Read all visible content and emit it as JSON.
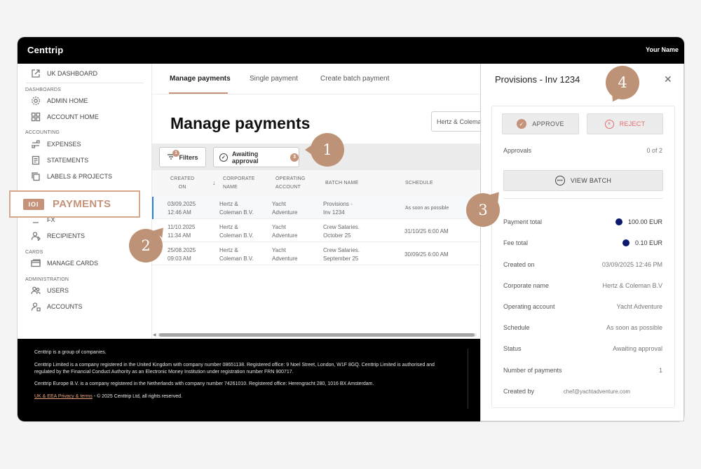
{
  "app": {
    "brand": "Centtrip",
    "user": "Your Name"
  },
  "sidebar": {
    "top_item": {
      "label": "UK DASHBOARD",
      "icon": "external-link-icon"
    },
    "sections": [
      {
        "title": "DASHBOARDS",
        "items": [
          {
            "label": "ADMIN HOME",
            "icon": "gear-icon"
          },
          {
            "label": "ACCOUNT HOME",
            "icon": "grid-icon"
          }
        ]
      },
      {
        "title": "ACCOUNTING",
        "items": [
          {
            "label": "EXPENSES",
            "icon": "receipt-swap-icon"
          },
          {
            "label": "STATEMENTS",
            "icon": "document-icon"
          },
          {
            "label": "LABELS & PROJECTS",
            "icon": "copy-icon"
          }
        ]
      },
      {
        "title": "",
        "items": [
          {
            "label": "PAYMENTS",
            "icon": "payments-icon"
          },
          {
            "label": "FX",
            "icon": "exchange-icon"
          },
          {
            "label": "RECIPIENTS",
            "icon": "recipients-icon"
          }
        ]
      },
      {
        "title": "CARDS",
        "items": [
          {
            "label": "MANAGE CARDS",
            "icon": "card-icon"
          }
        ]
      },
      {
        "title": "ADMINISTRATION",
        "items": [
          {
            "label": "USERS",
            "icon": "users-icon"
          },
          {
            "label": "ACCOUNTS",
            "icon": "accounts-icon"
          }
        ]
      }
    ],
    "highlight": {
      "icon_text": "IOI",
      "label": "PAYMENTS"
    }
  },
  "main": {
    "tabs": [
      {
        "label": "Manage payments",
        "active": true
      },
      {
        "label": "Single payment",
        "active": false
      },
      {
        "label": "Create batch payment",
        "active": false
      }
    ],
    "page_title": "Manage payments",
    "corporate_select": "Hertz & Coleman B.V",
    "filters": {
      "label": "Filters",
      "count": "1"
    },
    "awaiting": {
      "label": "Awaiting approval",
      "count": "3"
    },
    "table": {
      "headers": {
        "created_on_1": "CREATED",
        "created_on_2": "ON",
        "corporate_1": "CORPORATE",
        "corporate_2": "NAME",
        "account_1": "OPERATING",
        "account_2": "ACCOUNT",
        "batch": "BATCH NAME",
        "schedule": "SCHEDULE"
      },
      "rows": [
        {
          "date": "03/09.2025",
          "time": "12:46 AM",
          "corp1": "Hertz &",
          "corp2": "Coleman B.V.",
          "acc1": "Yacht",
          "acc2": "Adventure",
          "batch1": "Provisions -",
          "batch2": "Inv 1234",
          "schedule": "As soon as possible"
        },
        {
          "date": "11/10.2025",
          "time": "11:34 AM",
          "corp1": "Hertz &",
          "corp2": "Coleman B.V.",
          "acc1": "Yacht",
          "acc2": "Adventure",
          "batch1": "Crew Salaries.",
          "batch2": "October 25",
          "schedule": "31/10/25 6:00 AM"
        },
        {
          "date": "25/08.2025",
          "time": "09:03 AM",
          "corp1": "Hertz &",
          "corp2": "Coleman B.V.",
          "acc1": "Yacht",
          "acc2": "Adventure",
          "batch1": "Crew Salaries.",
          "batch2": "September 25",
          "schedule": "30/09/25 6:00 AM"
        }
      ]
    }
  },
  "footer": {
    "line1": "Centtrip is a group of companies.",
    "line2": "Centtrip Limited is a company registered in the United Kingdom with company number 08651138. Registered office: 9 Noel Street, London, W1F 8GQ. Centtrip Limited is authorised and regulated by the Financial Conduct Authority as an Electronic Money Institution under registration number FRN 900717.",
    "line3": "Centtrip Europe B.V. is a company registered in the Netherlands with company number 74261010. Registered office: Herengracht 280, 1016 BX Amsterdam.",
    "link": "UK & EEA Privacy & terms",
    "copyright": " - © 2025 Centtrip Ltd, all rights reserved."
  },
  "panel": {
    "title": "Provisions - Inv 1234",
    "approve": "APPROVE",
    "reject": "REJECT",
    "approvals_label": "Approvals",
    "approvals_value": "0 of 2",
    "view_batch": "VIEW BATCH",
    "details": [
      {
        "label": "Payment total",
        "value": "100.00 EUR",
        "dot": true
      },
      {
        "label": "Fee total",
        "value": "0.10 EUR",
        "dot": true
      },
      {
        "label": "Created on",
        "value": "03/09/2025 12:46 PM"
      },
      {
        "label": "Corporate name",
        "value": "Hertz & Coleman B.V"
      },
      {
        "label": "Operating account",
        "value": "Yacht Adventure"
      },
      {
        "label": "Schedule",
        "value": "As soon as possible"
      },
      {
        "label": "Status",
        "value": "Awaiting approval"
      },
      {
        "label": "Number of payments",
        "value": "1"
      },
      {
        "label": "Created by",
        "value": "chef@yachtadventure.com"
      }
    ]
  },
  "callouts": [
    "1",
    "2",
    "3",
    "4"
  ],
  "colors": {
    "accent": "#c4937a",
    "callout": "#bd9277",
    "reject": "#e46a6a",
    "selected_bar": "#2f7fd6",
    "currency_dot": "#0b1a6e"
  }
}
